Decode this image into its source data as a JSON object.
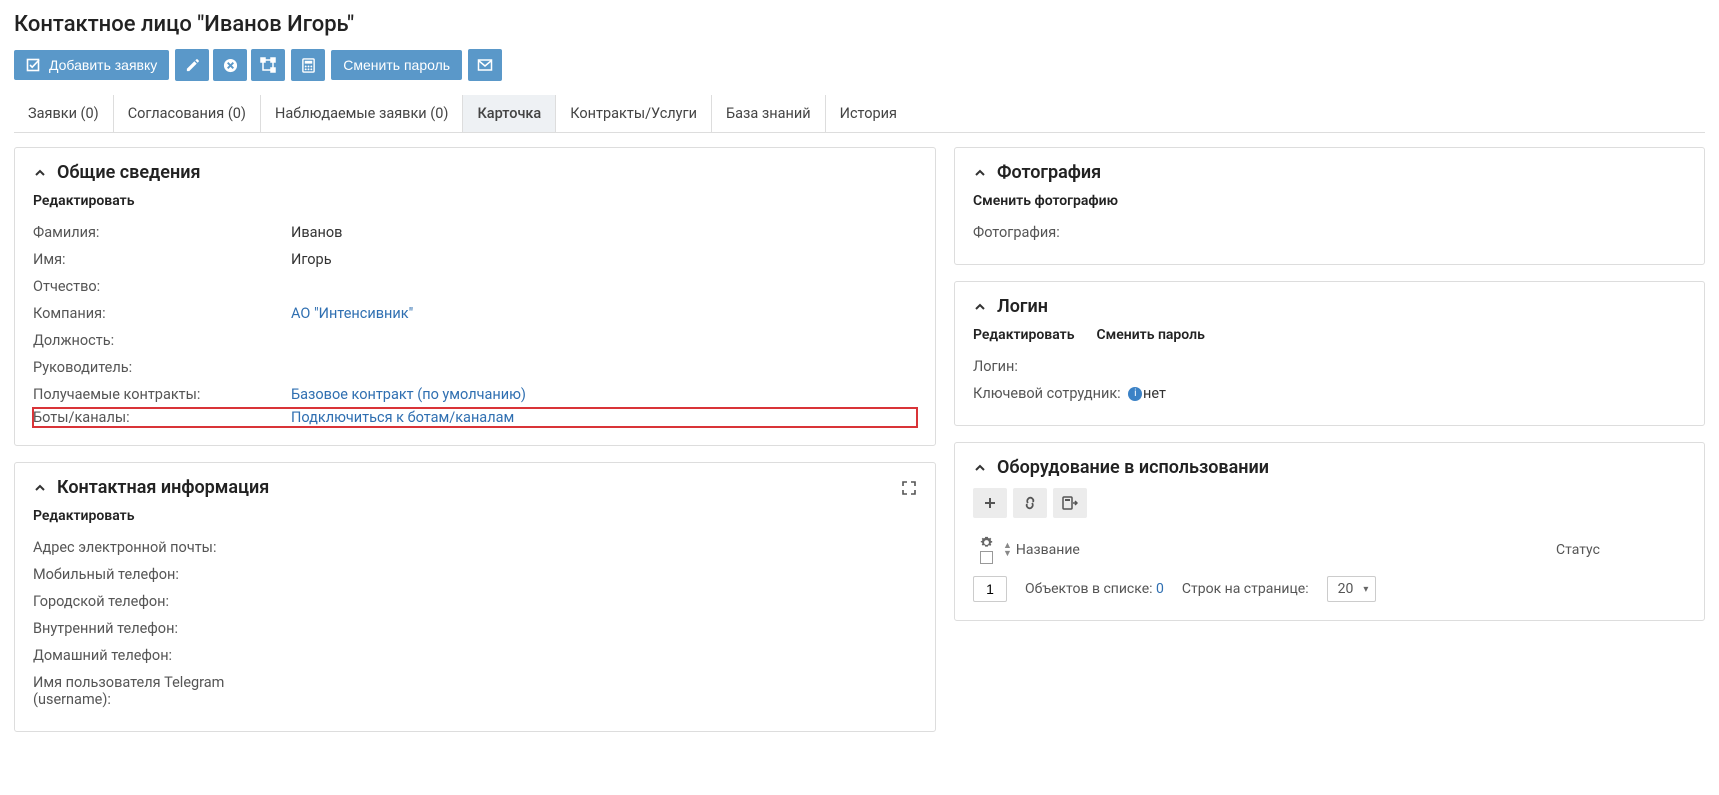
{
  "header": {
    "title": "Контактное лицо \"Иванов Игорь\""
  },
  "toolbar": {
    "add_ticket": "Добавить заявку",
    "change_password": "Сменить пароль"
  },
  "tabs": [
    {
      "label": "Заявки (0)"
    },
    {
      "label": "Согласования (0)"
    },
    {
      "label": "Наблюдаемые заявки (0)"
    },
    {
      "label": "Карточка",
      "active": true
    },
    {
      "label": "Контракты/Услуги"
    },
    {
      "label": "База знаний"
    },
    {
      "label": "История"
    }
  ],
  "general": {
    "title": "Общие сведения",
    "edit": "Редактировать",
    "fields": {
      "surname_label": "Фамилия:",
      "surname_value": "Иванов",
      "name_label": "Имя:",
      "name_value": "Игорь",
      "patronymic_label": "Отчество:",
      "patronymic_value": "",
      "company_label": "Компания:",
      "company_value": "АО \"Интенсивник\"",
      "position_label": "Должность:",
      "position_value": "",
      "manager_label": "Руководитель:",
      "manager_value": "",
      "contracts_label": "Получаемые контракты:",
      "contracts_value": "Базовое контракт (по умолчанию)",
      "bots_label": "Боты/каналы:",
      "bots_value": "Подключиться к ботам/каналам"
    }
  },
  "contact": {
    "title": "Контактная информация",
    "edit": "Редактировать",
    "fields": {
      "email_label": "Адрес электронной почты:",
      "mobile_label": "Мобильный телефон:",
      "city_phone_label": "Городской телефон:",
      "internal_label": "Внутренний телефон:",
      "home_label": "Домашний телефон:",
      "telegram_label": "Имя пользователя Telegram (username):"
    }
  },
  "photo": {
    "title": "Фотография",
    "change": "Сменить фотографию",
    "label": "Фотография:"
  },
  "login": {
    "title": "Логин",
    "edit": "Редактировать",
    "change_pw": "Сменить пароль",
    "login_label": "Логин:",
    "login_value": "",
    "key_label": "Ключевой сотрудник:",
    "key_value": "нет"
  },
  "equipment": {
    "title": "Оборудование в использовании",
    "col_name": "Название",
    "col_status": "Статус",
    "page": "1",
    "objects_label": "Объектов в списке:",
    "objects_count": "0",
    "rows_label": "Строк на странице:",
    "rows_value": "20"
  }
}
